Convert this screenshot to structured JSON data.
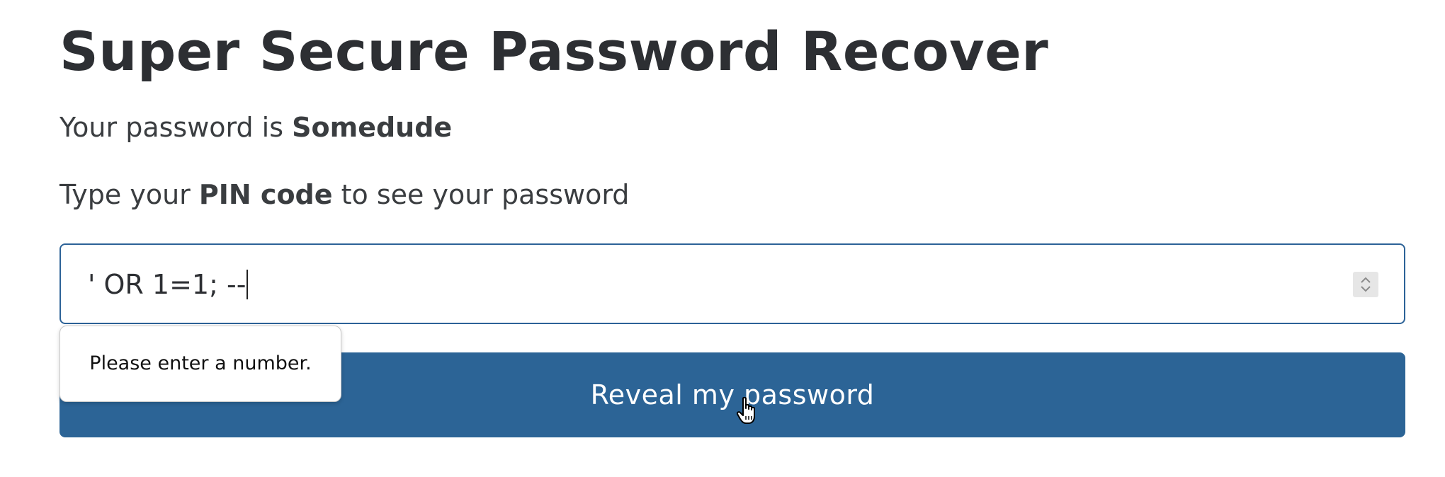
{
  "page": {
    "title": "Super Secure Password Recover",
    "password_prefix": "Your password is ",
    "password_value": "Somedude",
    "pin_prompt_before": "Type your ",
    "pin_prompt_bold": "PIN code",
    "pin_prompt_after": " to see your password"
  },
  "form": {
    "pin_input_value": "' OR 1=1; --",
    "submit_label": "Reveal my password",
    "validation_message": "Please enter a number."
  },
  "colors": {
    "accent": "#2c6496",
    "text": "#373a3c",
    "focus_border": "#2c6297"
  },
  "icons": {
    "spinner": "number-spinner-icon",
    "cursor": "hand-pointer-cursor"
  }
}
